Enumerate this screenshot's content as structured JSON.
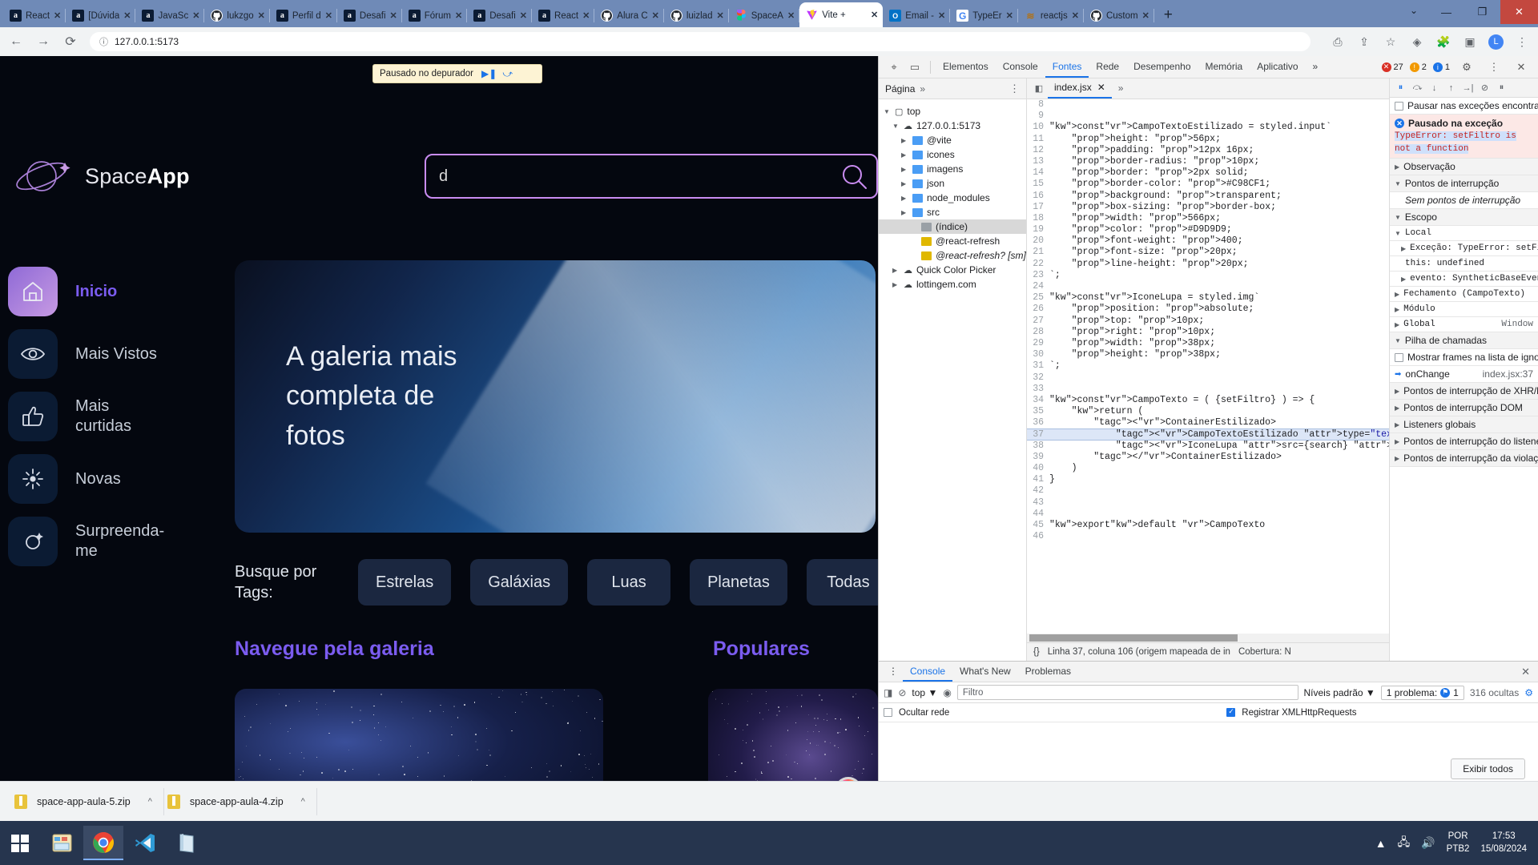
{
  "browser": {
    "tabs": [
      {
        "title": "React",
        "icon": "alura-icon"
      },
      {
        "title": "[Dúvida",
        "icon": "alura-icon"
      },
      {
        "title": "JavaSc",
        "icon": "alura-icon"
      },
      {
        "title": "lukzgo",
        "icon": "github-icon"
      },
      {
        "title": "Perfil d",
        "icon": "alura-icon"
      },
      {
        "title": "Desafi",
        "icon": "alura-icon"
      },
      {
        "title": "Fórum",
        "icon": "alura-icon"
      },
      {
        "title": "Desafi",
        "icon": "alura-icon"
      },
      {
        "title": "React",
        "icon": "alura-icon"
      },
      {
        "title": "Alura C",
        "icon": "github-icon"
      },
      {
        "title": "luizlad",
        "icon": "github-icon"
      },
      {
        "title": "SpaceA",
        "icon": "figma-icon"
      },
      {
        "title": "Vite +",
        "icon": "vite-icon",
        "active": true
      },
      {
        "title": "Email -",
        "icon": "outlook-icon"
      },
      {
        "title": "TypeEr",
        "icon": "google-icon"
      },
      {
        "title": "reactjs",
        "icon": "java-icon"
      },
      {
        "title": "Custom",
        "icon": "github-icon"
      }
    ],
    "new_tab_label": "+",
    "close_tab_label": "✕",
    "window_controls": {
      "minimize": "—",
      "maximize": "❐",
      "close": "✕",
      "list_chevron": "⌄"
    },
    "url": "127.0.0.1:5173",
    "nav": {
      "back": "←",
      "forward": "→",
      "reload": "⟳",
      "info_icon": "ⓘ"
    },
    "nav_right": {
      "cast": "⎙",
      "share": "⇪",
      "star": "☆",
      "ext_puzzle": "🧩",
      "profile": "L",
      "menu": "⋮",
      "win": "▣",
      "shield": "◈"
    }
  },
  "page": {
    "paused_bar": {
      "text": "Pausado no depurador",
      "resume_icon": "▶❚",
      "step_icon": "⤻"
    },
    "search": {
      "value": "d",
      "placeholder": ""
    },
    "logo": {
      "name_light": "Space",
      "name_bold": "App"
    },
    "nav_items": [
      {
        "label": "Inicio",
        "icon": "home-icon",
        "active": true
      },
      {
        "label": "Mais Vistos",
        "icon": "eye-icon",
        "active": false
      },
      {
        "label": "Mais curtidas",
        "icon": "thumbs-up-icon",
        "active": false
      },
      {
        "label": "Novas",
        "icon": "sun-icon",
        "active": false
      },
      {
        "label": "Surpreenda-me",
        "icon": "sparkle-icon",
        "active": false
      }
    ],
    "hero_title": "A galeria mais completa de fotos",
    "tags_label": "Busque por Tags:",
    "tags": [
      "Estrelas",
      "Galáxias",
      "Luas",
      "Planetas",
      "Todas"
    ],
    "section_gallery": "Navegue pela galeria",
    "section_popular": "Populares"
  },
  "devtools": {
    "toolbar": {
      "inspect_icon": "⌖",
      "device_icon": "▭",
      "tabs": [
        "Elementos",
        "Console",
        "Fontes",
        "Rede",
        "Desempenho",
        "Memória",
        "Aplicativo"
      ],
      "active_tab": "Fontes",
      "overflow": "»",
      "errors": "27",
      "warnings": "2",
      "infos": "1",
      "settings_icon": "⚙",
      "more_icon": "⋮",
      "close_icon": "✕"
    },
    "navigator": {
      "header": "Página",
      "overflow": "»",
      "more": "⋮",
      "tree": [
        {
          "label": "top",
          "depth": 0,
          "icon": "frame-icon",
          "twisty": "▼"
        },
        {
          "label": "127.0.0.1:5173",
          "depth": 1,
          "icon": "cloud-icon",
          "twisty": "▼"
        },
        {
          "label": "@vite",
          "depth": 2,
          "icon": "folder-blue",
          "twisty": "▶"
        },
        {
          "label": "icones",
          "depth": 2,
          "icon": "folder-blue",
          "twisty": "▶"
        },
        {
          "label": "imagens",
          "depth": 2,
          "icon": "folder-blue",
          "twisty": "▶"
        },
        {
          "label": "json",
          "depth": 2,
          "icon": "folder-blue",
          "twisty": "▶"
        },
        {
          "label": "node_modules",
          "depth": 2,
          "icon": "folder-blue",
          "twisty": "▶"
        },
        {
          "label": "src",
          "depth": 2,
          "icon": "folder-blue",
          "twisty": "▶"
        },
        {
          "label": "(índice)",
          "depth": 3,
          "icon": "doc-icon",
          "twisty": "",
          "selected": true
        },
        {
          "label": "@react-refresh",
          "depth": 3,
          "icon": "file-yellow",
          "twisty": ""
        },
        {
          "label": "@react-refresh? [sm]",
          "depth": 3,
          "icon": "file-yellow",
          "twisty": "",
          "italic": true
        },
        {
          "label": "Quick Color Picker",
          "depth": 1,
          "icon": "cloud-icon",
          "twisty": "▶"
        },
        {
          "label": "lottingem.com",
          "depth": 1,
          "icon": "cloud-icon",
          "twisty": "▶"
        }
      ]
    },
    "editor": {
      "file_tab": "index.jsx",
      "file_close": "✕",
      "overflow": "»",
      "back_icon": "◧",
      "lines": [
        {
          "n": 8,
          "text": ""
        },
        {
          "n": 9,
          "text": ""
        },
        {
          "n": 10,
          "text": "const CampoTextoEstilizado = styled.input`"
        },
        {
          "n": 11,
          "text": "    height: 56px;"
        },
        {
          "n": 12,
          "text": "    padding: 12px 16px;"
        },
        {
          "n": 13,
          "text": "    border-radius: 10px;"
        },
        {
          "n": 14,
          "text": "    border: 2px solid;"
        },
        {
          "n": 15,
          "text": "    border-color: #C98CF1;"
        },
        {
          "n": 16,
          "text": "    background: transparent;"
        },
        {
          "n": 17,
          "text": "    box-sizing: border-box;"
        },
        {
          "n": 18,
          "text": "    width: 566px;"
        },
        {
          "n": 19,
          "text": "    color: #D9D9D9;"
        },
        {
          "n": 20,
          "text": "    font-weight: 400;"
        },
        {
          "n": 21,
          "text": "    font-size: 20px;"
        },
        {
          "n": 22,
          "text": "    line-height: 20px;"
        },
        {
          "n": 23,
          "text": "`;"
        },
        {
          "n": 24,
          "text": ""
        },
        {
          "n": 25,
          "text": "const IconeLupa = styled.img`"
        },
        {
          "n": 26,
          "text": "    position: absolute;"
        },
        {
          "n": 27,
          "text": "    top: 10px;"
        },
        {
          "n": 28,
          "text": "    right: 10px;"
        },
        {
          "n": 29,
          "text": "    width: 38px;"
        },
        {
          "n": 30,
          "text": "    height: 38px;"
        },
        {
          "n": 31,
          "text": "`;"
        },
        {
          "n": 32,
          "text": ""
        },
        {
          "n": 33,
          "text": ""
        },
        {
          "n": 34,
          "text": "const CampoTexto = ( {setFiltro} ) => {"
        },
        {
          "n": 35,
          "text": "    return ("
        },
        {
          "n": 36,
          "text": "        <ContainerEstilizado>"
        },
        {
          "n": 37,
          "text": "            <CampoTextoEstilizado type=\"text\"",
          "highlight": true
        },
        {
          "n": 38,
          "text": "            <IconeLupa src={search} alt=\"ícon"
        },
        {
          "n": 39,
          "text": "        </ContainerEstilizado>"
        },
        {
          "n": 40,
          "text": "    )"
        },
        {
          "n": 41,
          "text": "}"
        },
        {
          "n": 42,
          "text": ""
        },
        {
          "n": 43,
          "text": ""
        },
        {
          "n": 44,
          "text": ""
        },
        {
          "n": 45,
          "text": "export default CampoTexto"
        },
        {
          "n": 46,
          "text": ""
        }
      ],
      "status": {
        "format_icon": "{}",
        "position": "Linha 37, coluna 106 (origem mapeada de in",
        "coverage": "Cobertura: N"
      }
    },
    "debugger": {
      "toolbar": {
        "pause": "⏸",
        "step_over": "⤼",
        "step_into": "↓",
        "step_out": "↑",
        "step": "→|",
        "deactivate": "⊘",
        "pause_exceptions": "⏸"
      },
      "pause_on_exceptions_label": "Pausar nas exceções encontradas",
      "paused_title": "Pausado na exceção",
      "paused_message": "TypeError: setFiltro is not a function",
      "sections": [
        {
          "label": "Observação",
          "twisty": "▶"
        },
        {
          "label": "Pontos de interrupção",
          "twisty": "▼"
        },
        {
          "label": "Sem pontos de interrupção",
          "italic": true,
          "indent": true
        },
        {
          "label": "Escopo",
          "twisty": "▼"
        },
        {
          "label": "Local",
          "twisty": "▼",
          "mono": true
        },
        {
          "label": "Exceção: TypeError: setFiltro i",
          "twisty": "▶",
          "mono": true,
          "indent": true
        },
        {
          "label": "this: undefined",
          "twisty": "",
          "mono": true,
          "indent": true
        },
        {
          "label": "evento: SyntheticBaseEvent {_re",
          "twisty": "▶",
          "mono": true,
          "indent": true
        },
        {
          "label": "Fechamento (CampoTexto)",
          "twisty": "▶",
          "mono": true
        },
        {
          "label": "Módulo",
          "twisty": "▶",
          "mono": true
        },
        {
          "label": "Global",
          "twisty": "▶",
          "mono": true,
          "right": "Window"
        },
        {
          "label": "Pilha de chamadas",
          "twisty": "▼"
        },
        {
          "label": "Mostrar frames na lista de ignorados",
          "checkbox": true
        },
        {
          "label": "onChange",
          "right": "index.jsx:37",
          "frame": true
        },
        {
          "label": "Pontos de interrupção de XHR/busca",
          "twisty": "▶"
        },
        {
          "label": "Pontos de interrupção DOM",
          "twisty": "▶"
        },
        {
          "label": "Listeners globais",
          "twisty": "▶"
        },
        {
          "label": "Pontos de interrupção do listener de ev",
          "twisty": "▶"
        },
        {
          "label": "Pontos de interrupção da violação de C",
          "twisty": "▶"
        }
      ]
    },
    "drawer": {
      "tabs": [
        "Console",
        "What's New",
        "Problemas"
      ],
      "active_tab": "Console",
      "close": "✕",
      "more": "⋮",
      "console_bar": {
        "sidebar_icon": "◨",
        "clear_icon": "⊘",
        "context": "top",
        "context_chevron": "▼",
        "eye_icon": "◉",
        "filter_placeholder": "Filtro",
        "levels": "Níveis padrão",
        "levels_chevron": "▼",
        "problems": "1 problema:",
        "problems_count": "1",
        "hidden": "316 ocultas",
        "settings": "⚙"
      },
      "options": {
        "hide_network": "Ocultar rede",
        "log_xhr": "Registrar XMLHttpRequests"
      },
      "show_all": "Exibir todos"
    }
  },
  "downloads": {
    "items": [
      {
        "name": "space-app-aula-5.zip",
        "caret": "^"
      },
      {
        "name": "space-app-aula-4.zip",
        "caret": "^"
      }
    ]
  },
  "taskbar": {
    "apps": [
      "windows-start",
      "file-explorer-icon",
      "chrome-icon",
      "vscode-icon",
      "notepad-icon"
    ],
    "tray": {
      "up_arrow": "▲",
      "network_icon": "🖧",
      "volume_icon": "🔊",
      "lang1": "POR",
      "lang2": "PTB2",
      "time": "17:53",
      "date": "15/08/2024"
    }
  }
}
